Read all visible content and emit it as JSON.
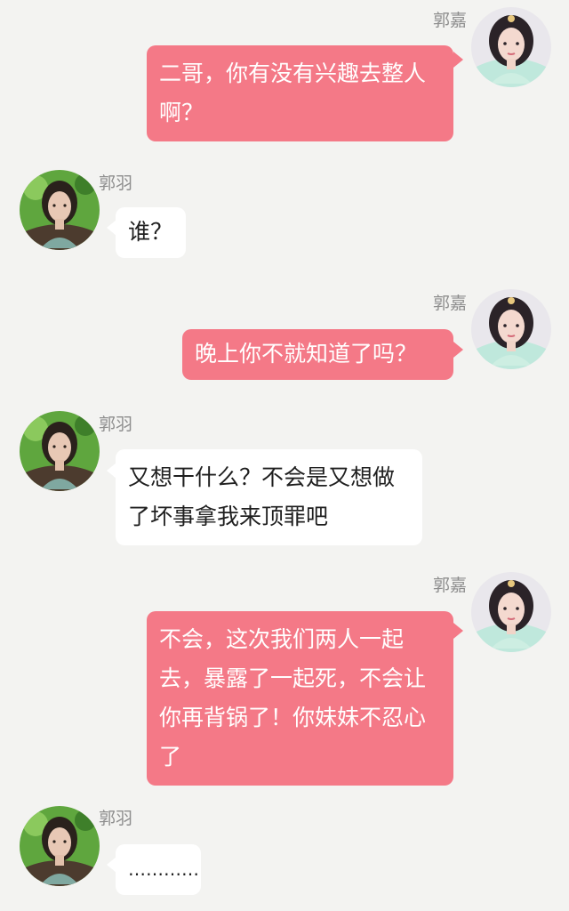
{
  "participants": {
    "sister": {
      "name": "郭嘉",
      "avatar_icon": "female-avatar-icon"
    },
    "brother": {
      "name": "郭羽",
      "avatar_icon": "male-avatar-icon"
    }
  },
  "colors": {
    "background": "#f3f3f1",
    "outgoing_bubble": "#f47987",
    "incoming_bubble": "#ffffff"
  },
  "messages": [
    {
      "sender": "郭嘉",
      "side": "right",
      "text": "二哥，你有没有兴趣去整人啊？"
    },
    {
      "sender": "郭羽",
      "side": "left",
      "text": "谁？"
    },
    {
      "sender": "郭嘉",
      "side": "right",
      "text": "晚上你不就知道了吗？"
    },
    {
      "sender": "郭羽",
      "side": "left",
      "text": "又想干什么？不会是又想做了坏事拿我来顶罪吧"
    },
    {
      "sender": "郭嘉",
      "side": "right",
      "text": "不会，这次我们两人一起去，暴露了一起死，不会让你再背锅了！你妹妹不忍心了"
    },
    {
      "sender": "郭羽",
      "side": "left",
      "text": "…………"
    }
  ]
}
